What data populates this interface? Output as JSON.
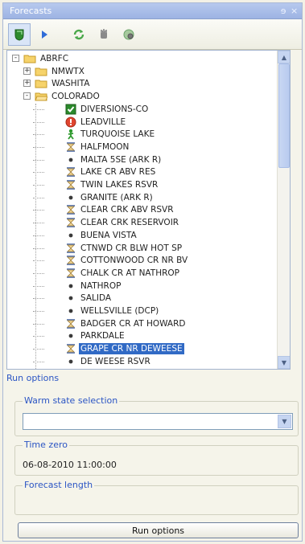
{
  "panel": {
    "title": "Forecasts",
    "controls": "ɘ ×"
  },
  "toolbar": {
    "buttons": [
      {
        "name": "forecast-shield",
        "color": "#2e8b2e"
      },
      {
        "name": "run",
        "color": "#2f6cd8"
      },
      {
        "name": "refresh",
        "color": "#4aa84a"
      },
      {
        "name": "stop",
        "color": "#8a8a8a"
      },
      {
        "name": "settings",
        "color": "#6aa36a"
      }
    ]
  },
  "tree": {
    "nodes": [
      {
        "label": "ABRFC",
        "icon": "folder",
        "expand": "-",
        "level": 0
      },
      {
        "label": "NMWTX",
        "icon": "folder",
        "expand": "+",
        "level": 1
      },
      {
        "label": "WASHITA",
        "icon": "folder",
        "expand": "+",
        "level": 1
      },
      {
        "label": "COLORADO",
        "icon": "folder-open",
        "expand": "-",
        "level": 1
      },
      {
        "label": "DIVERSIONS-CO",
        "icon": "check-icon",
        "level": 2
      },
      {
        "label": "LEADVILLE",
        "icon": "error-icon",
        "level": 2
      },
      {
        "label": "TURQUOISE LAKE",
        "icon": "run-person-icon",
        "level": 2
      },
      {
        "label": "HALFMOON",
        "icon": "hourglass-icon",
        "level": 2
      },
      {
        "label": "MALTA 5SE (ARK R)",
        "icon": "dot-icon",
        "level": 2
      },
      {
        "label": "LAKE CR ABV RES",
        "icon": "hourglass-icon",
        "level": 2
      },
      {
        "label": "TWIN LAKES RSVR",
        "icon": "hourglass-icon",
        "level": 2
      },
      {
        "label": "GRANITE (ARK R)",
        "icon": "dot-icon",
        "level": 2
      },
      {
        "label": "CLEAR CRK ABV RSVR",
        "icon": "hourglass-icon",
        "level": 2
      },
      {
        "label": "CLEAR CRK RESERVOIR",
        "icon": "hourglass-icon",
        "level": 2
      },
      {
        "label": "BUENA VISTA",
        "icon": "dot-icon",
        "level": 2
      },
      {
        "label": "CTNWD CR BLW HOT SP",
        "icon": "hourglass-icon",
        "level": 2
      },
      {
        "label": "COTTONWOOD CR NR BV",
        "icon": "hourglass-icon",
        "level": 2
      },
      {
        "label": "CHALK CR AT NATHROP",
        "icon": "hourglass-icon",
        "level": 2
      },
      {
        "label": "NATHROP",
        "icon": "dot-icon",
        "level": 2
      },
      {
        "label": "SALIDA",
        "icon": "dot-icon",
        "level": 2
      },
      {
        "label": "WELLSVILLE (DCP)",
        "icon": "dot-icon",
        "level": 2
      },
      {
        "label": "BADGER CR AT HOWARD",
        "icon": "hourglass-icon",
        "level": 2
      },
      {
        "label": "PARKDALE",
        "icon": "dot-icon",
        "level": 2
      },
      {
        "label": "GRAPE CR NR DEWEESE",
        "icon": "hourglass-icon",
        "level": 2,
        "selected": true
      },
      {
        "label": "DE WEESE RSVR",
        "icon": "dot-icon",
        "level": 2
      }
    ]
  },
  "run_options": {
    "section_label": "Run options",
    "warm_state": {
      "label": "Warm state selection",
      "value": ""
    },
    "time_zero": {
      "label": "Time zero",
      "value": "06-08-2010 11:00:00"
    },
    "forecast_length": {
      "label": "Forecast length"
    },
    "button_label": "Run options"
  }
}
